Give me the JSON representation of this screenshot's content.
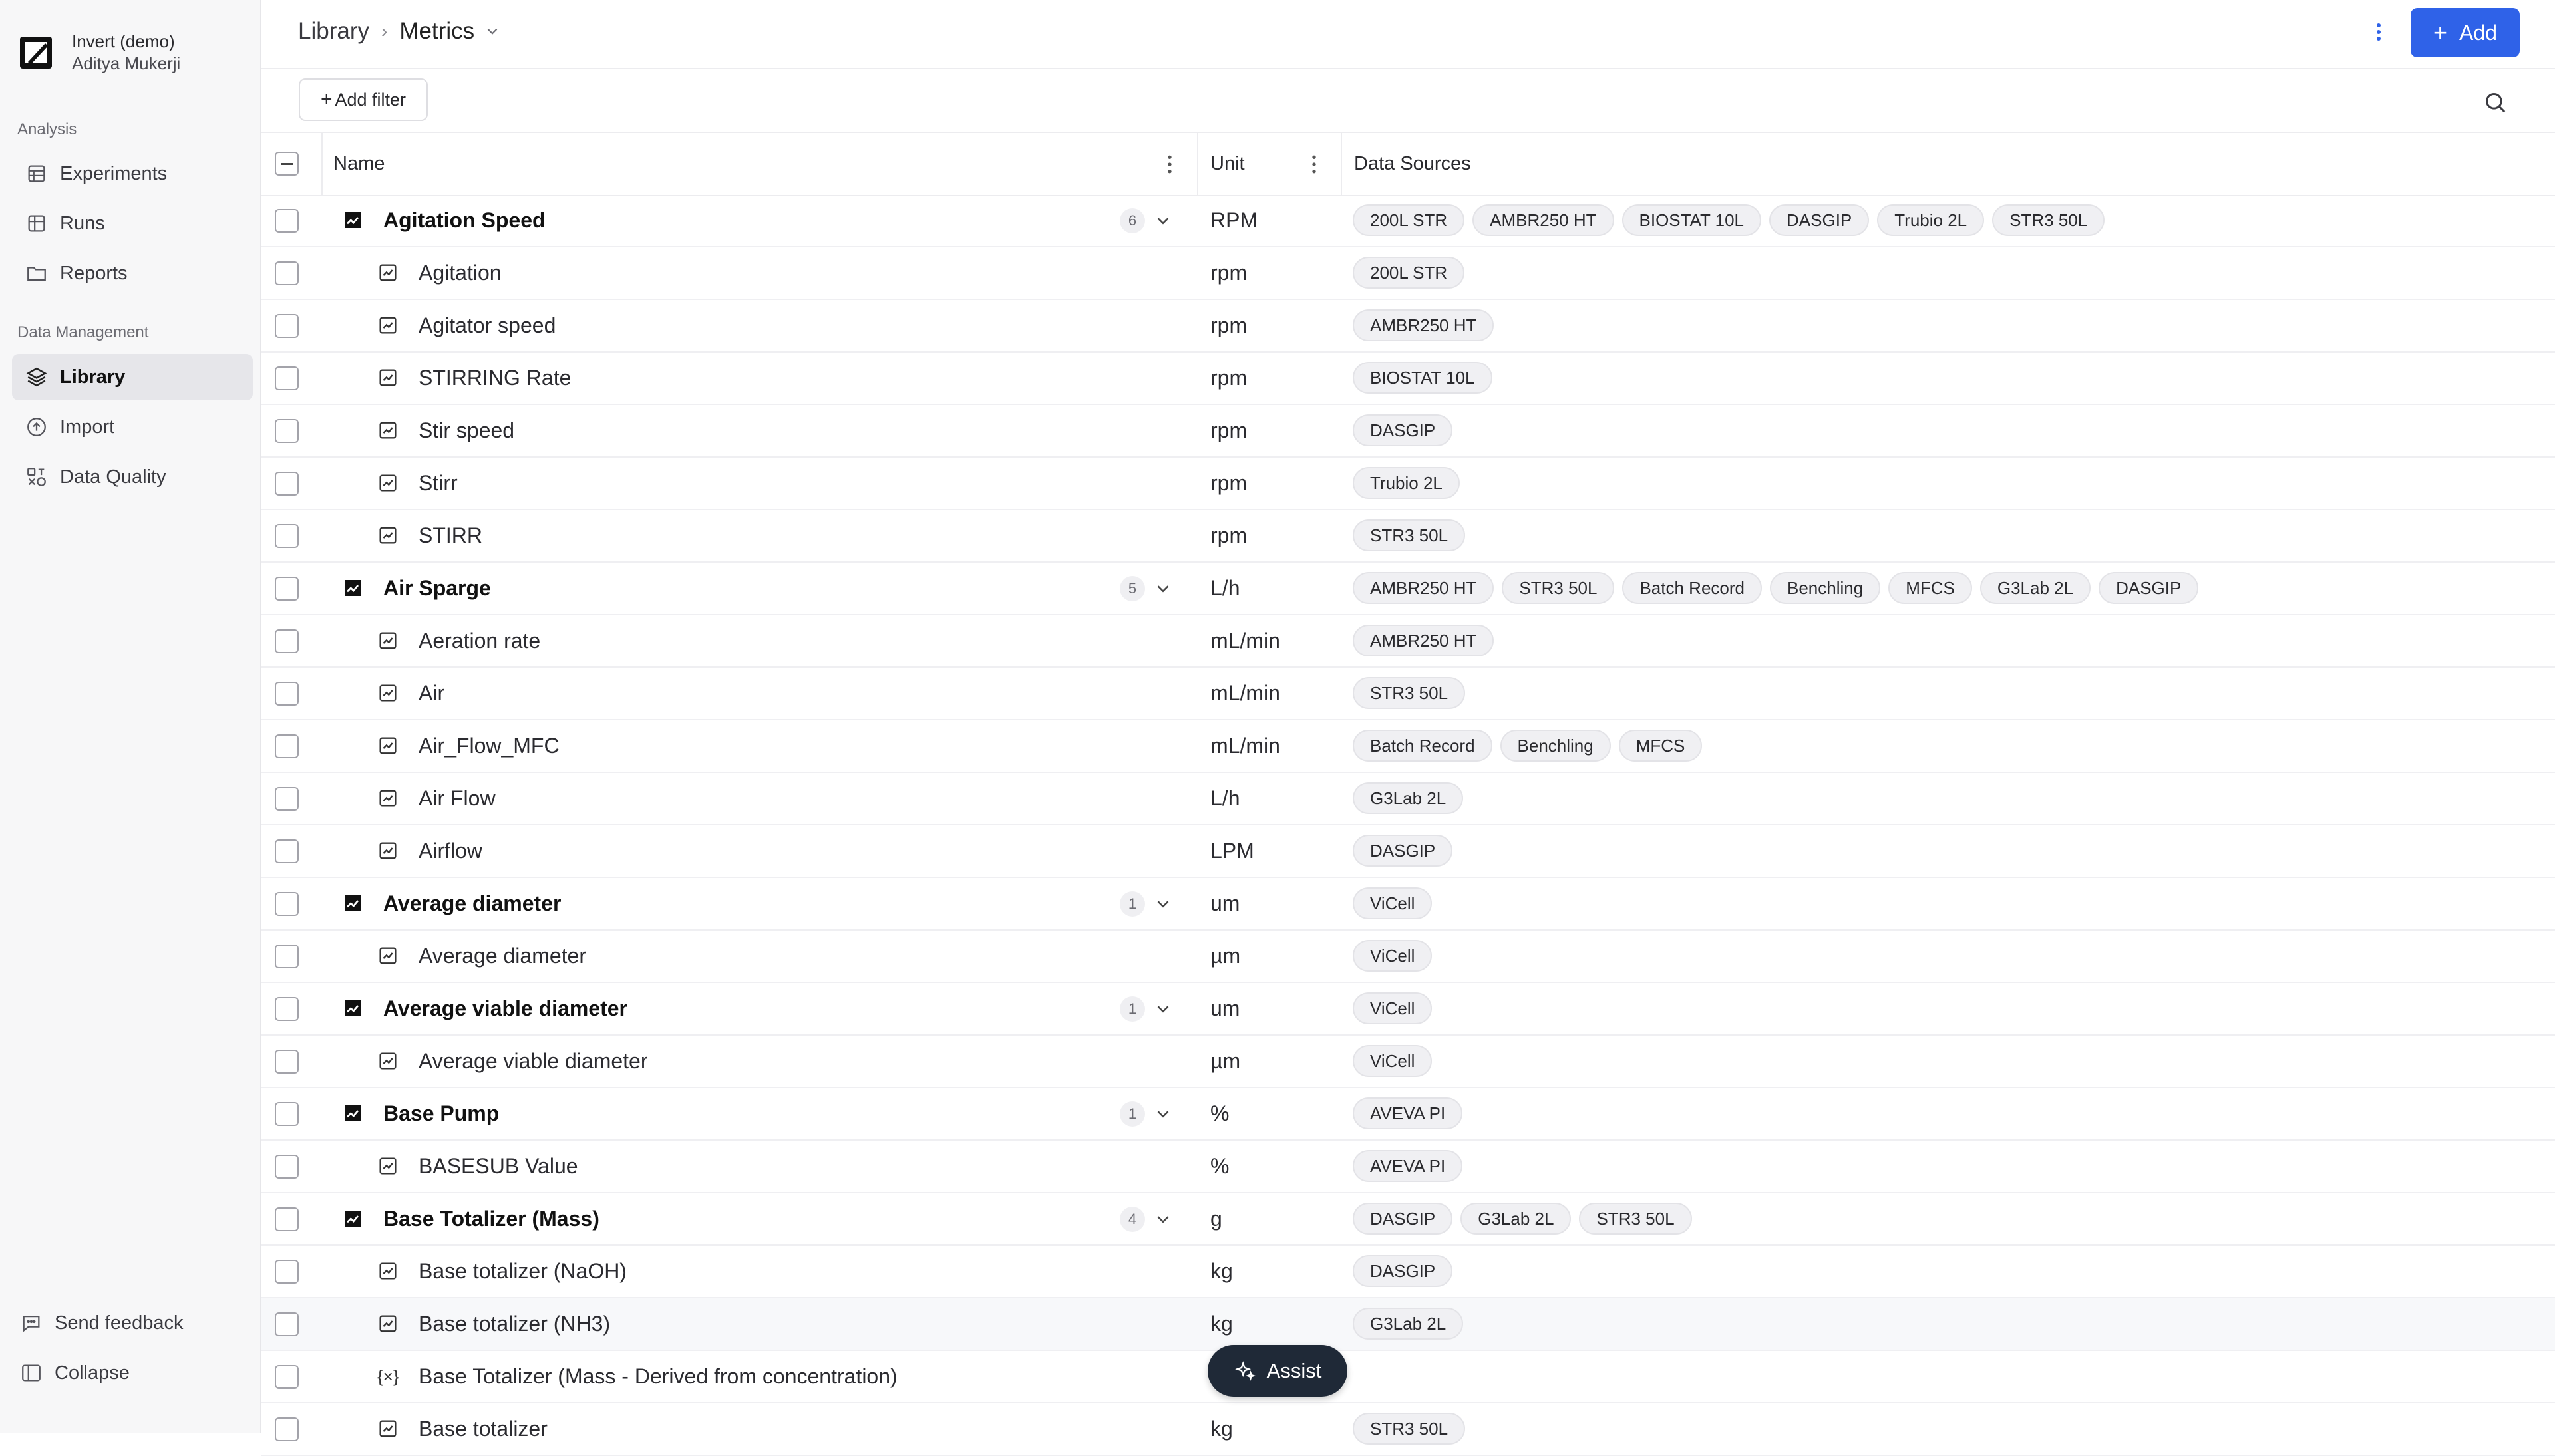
{
  "workspace": {
    "org_name": "Invert (demo)",
    "user_name": "Aditya Mukerji"
  },
  "sidebar": {
    "sections": [
      {
        "label": "Analysis",
        "items": [
          {
            "label": "Experiments",
            "icon": "table-icon"
          },
          {
            "label": "Runs",
            "icon": "grid-icon"
          },
          {
            "label": "Reports",
            "icon": "folder-icon"
          }
        ]
      },
      {
        "label": "Data Management",
        "items": [
          {
            "label": "Library",
            "icon": "layers-icon",
            "active": true
          },
          {
            "label": "Import",
            "icon": "upload-icon"
          },
          {
            "label": "Data Quality",
            "icon": "quality-icon"
          }
        ]
      }
    ],
    "footer": {
      "feedback": "Send feedback",
      "collapse": "Collapse"
    }
  },
  "header": {
    "breadcrumb": [
      "Library",
      "Metrics"
    ],
    "add_label": "Add"
  },
  "toolbar": {
    "add_filter_label": "Add filter"
  },
  "table": {
    "columns": {
      "name": "Name",
      "unit": "Unit",
      "sources": "Data Sources"
    },
    "rows": [
      {
        "type": "parent",
        "name": "Agitation Speed",
        "count": "6",
        "unit": "RPM",
        "sources": [
          "200L STR",
          "AMBR250 HT",
          "BIOSTAT 10L",
          "DASGIP",
          "Trubio 2L",
          "STR3 50L"
        ]
      },
      {
        "type": "child",
        "name": "Agitation",
        "unit": "rpm",
        "sources": [
          "200L STR"
        ]
      },
      {
        "type": "child",
        "name": "Agitator speed",
        "unit": "rpm",
        "sources": [
          "AMBR250 HT"
        ]
      },
      {
        "type": "child",
        "name": "STIRRING Rate",
        "unit": "rpm",
        "sources": [
          "BIOSTAT 10L"
        ]
      },
      {
        "type": "child",
        "name": "Stir speed",
        "unit": "rpm",
        "sources": [
          "DASGIP"
        ]
      },
      {
        "type": "child",
        "name": "Stirr",
        "unit": "rpm",
        "sources": [
          "Trubio 2L"
        ]
      },
      {
        "type": "child",
        "name": "STIRR",
        "unit": "rpm",
        "sources": [
          "STR3 50L"
        ]
      },
      {
        "type": "parent",
        "name": "Air Sparge",
        "count": "5",
        "unit": "L/h",
        "sources": [
          "AMBR250 HT",
          "STR3 50L",
          "Batch Record",
          "Benchling",
          "MFCS",
          "G3Lab 2L",
          "DASGIP"
        ]
      },
      {
        "type": "child",
        "name": "Aeration rate",
        "unit": "mL/min",
        "sources": [
          "AMBR250 HT"
        ]
      },
      {
        "type": "child",
        "name": "Air",
        "unit": "mL/min",
        "sources": [
          "STR3 50L"
        ]
      },
      {
        "type": "child",
        "name": "Air_Flow_MFC",
        "unit": "mL/min",
        "sources": [
          "Batch Record",
          "Benchling",
          "MFCS"
        ]
      },
      {
        "type": "child",
        "name": "Air Flow",
        "unit": "L/h",
        "sources": [
          "G3Lab 2L"
        ]
      },
      {
        "type": "child",
        "name": "Airflow",
        "unit": "LPM",
        "sources": [
          "DASGIP"
        ]
      },
      {
        "type": "parent",
        "name": "Average diameter",
        "count": "1",
        "unit": "um",
        "sources": [
          "ViCell"
        ]
      },
      {
        "type": "child",
        "name": "Average diameter",
        "unit": "µm",
        "sources": [
          "ViCell"
        ]
      },
      {
        "type": "parent",
        "name": "Average viable diameter",
        "count": "1",
        "unit": "um",
        "sources": [
          "ViCell"
        ]
      },
      {
        "type": "child",
        "name": "Average viable diameter",
        "unit": "µm",
        "sources": [
          "ViCell"
        ]
      },
      {
        "type": "parent",
        "name": "Base Pump",
        "count": "1",
        "unit": "%",
        "sources": [
          "AVEVA PI"
        ]
      },
      {
        "type": "child",
        "name": "BASESUB Value",
        "unit": "%",
        "sources": [
          "AVEVA PI"
        ]
      },
      {
        "type": "parent",
        "name": "Base Totalizer (Mass)",
        "count": "4",
        "unit": "g",
        "sources": [
          "DASGIP",
          "G3Lab 2L",
          "STR3 50L"
        ]
      },
      {
        "type": "child",
        "name": "Base totalizer (NaOH)",
        "unit": "kg",
        "sources": [
          "DASGIP"
        ]
      },
      {
        "type": "child",
        "name": "Base totalizer (NH3)",
        "unit": "kg",
        "sources": [
          "G3Lab 2L"
        ],
        "highlight": true
      },
      {
        "type": "derived",
        "name": "Base Totalizer (Mass - Derived from concentration)",
        "unit": "",
        "sources": []
      },
      {
        "type": "child",
        "name": "Base totalizer",
        "unit": "kg",
        "sources": [
          "STR3 50L"
        ]
      }
    ]
  },
  "assist": {
    "label": "Assist"
  },
  "colors": {
    "accent": "#2f62e8",
    "assist_bg": "#1f2937"
  }
}
